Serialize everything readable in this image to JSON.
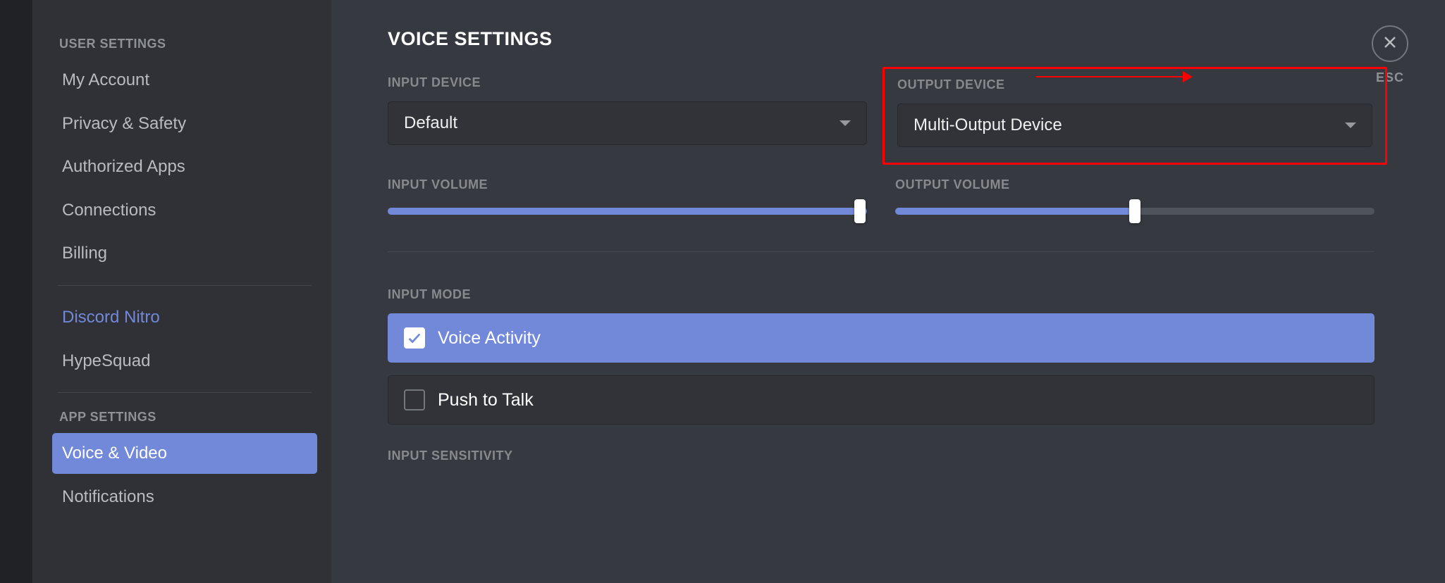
{
  "sidebar": {
    "userSettingsHeader": "USER SETTINGS",
    "appSettingsHeader": "APP SETTINGS",
    "items": [
      {
        "label": "My Account"
      },
      {
        "label": "Privacy & Safety"
      },
      {
        "label": "Authorized Apps"
      },
      {
        "label": "Connections"
      },
      {
        "label": "Billing"
      },
      {
        "label": "Discord Nitro"
      },
      {
        "label": "HypeSquad"
      },
      {
        "label": "Voice & Video"
      },
      {
        "label": "Notifications"
      }
    ]
  },
  "page": {
    "title": "VOICE SETTINGS",
    "inputDeviceLabel": "INPUT DEVICE",
    "inputDeviceValue": "Default",
    "outputDeviceLabel": "OUTPUT DEVICE",
    "outputDeviceValue": "Multi-Output Device",
    "inputVolumeLabel": "INPUT VOLUME",
    "outputVolumeLabel": "OUTPUT VOLUME",
    "inputVolumePercent": 100,
    "outputVolumePercent": 50,
    "inputModeLabel": "INPUT MODE",
    "voiceActivityLabel": "Voice Activity",
    "pushToTalkLabel": "Push to Talk",
    "inputSensitivityLabel": "INPUT SENSITIVITY"
  },
  "close": {
    "label": "ESC"
  }
}
